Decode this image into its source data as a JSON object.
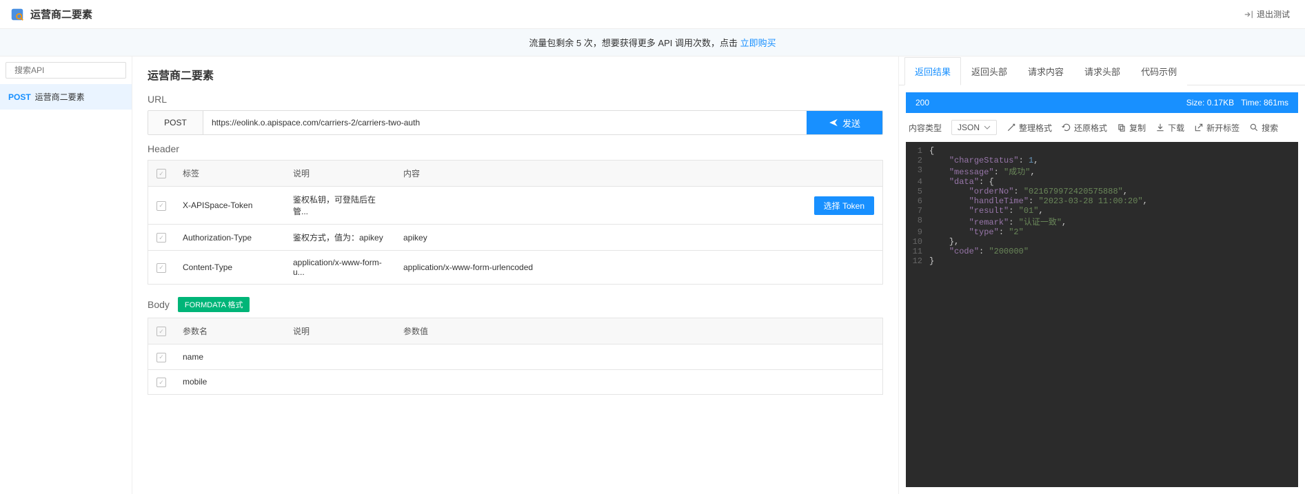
{
  "app": {
    "title": "运营商二要素",
    "exit_label": "退出测试"
  },
  "announce": {
    "prefix": "流量包剩余 ",
    "count": "5",
    "mid": " 次，想要获得更多 API 调用次数，点击 ",
    "link": "立即购买"
  },
  "search": {
    "placeholder": "搜索API"
  },
  "sidebar": {
    "items": [
      {
        "method": "POST",
        "label": "运营商二要素"
      }
    ]
  },
  "main": {
    "title": "运营商二要素",
    "url_label": "URL",
    "method": "POST",
    "url": "https://eolink.o.apispace.com/carriers-2/carriers-two-auth",
    "send": "发送",
    "header_label": "Header",
    "header_cols": {
      "tag": "标签",
      "desc": "说明",
      "content": "内容"
    },
    "headers": [
      {
        "tag": "X-APISpace-Token",
        "desc": "鉴权私钥，可登陆后在管...",
        "content": "",
        "token_btn": "选择 Token"
      },
      {
        "tag": "Authorization-Type",
        "desc": "鉴权方式，值为：apikey",
        "content": "apikey"
      },
      {
        "tag": "Content-Type",
        "desc": "application/x-www-form-u...",
        "content": "application/x-www-form-urlencoded"
      }
    ],
    "body_label": "Body",
    "body_badge": "FORMDATA 格式",
    "body_cols": {
      "name": "参数名",
      "desc": "说明",
      "val": "参数值"
    },
    "params": [
      {
        "name": "name",
        "desc": "",
        "val": ""
      },
      {
        "name": "mobile",
        "desc": "",
        "val": ""
      }
    ]
  },
  "right": {
    "tabs": [
      "返回结果",
      "返回头部",
      "请求内容",
      "请求头部",
      "代码示例"
    ],
    "status_code": "200",
    "size_label": "Size: 0.17KB",
    "time_label": "Time: 861ms",
    "content_type_label": "内容类型",
    "content_type_value": "JSON",
    "tools": {
      "format": "整理格式",
      "restore": "还原格式",
      "copy": "复制",
      "download": "下载",
      "newtab": "新开标签",
      "search": "搜索"
    }
  },
  "response_json": {
    "chargeStatus": 1,
    "message": "成功",
    "data": {
      "orderNo": "021679972420575888",
      "handleTime": "2023-03-28 11:00:20",
      "result": "01",
      "remark": "认证一致",
      "type": "2"
    },
    "code": "200000"
  }
}
